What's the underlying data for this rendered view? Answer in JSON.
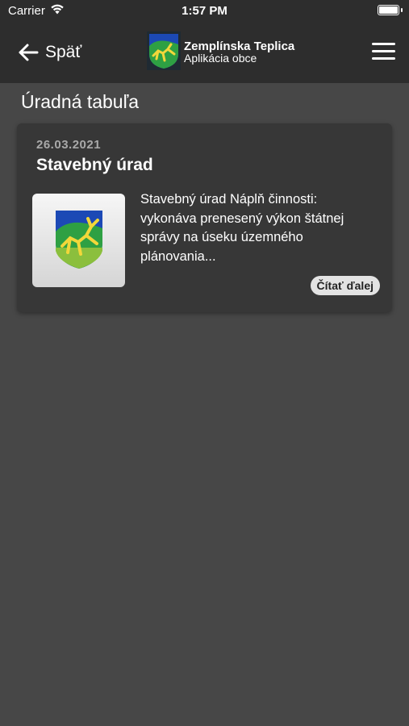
{
  "status_bar": {
    "carrier": "Carrier",
    "time": "1:57 PM",
    "icons": [
      "wifi-icon",
      "battery-icon"
    ]
  },
  "header": {
    "back_label": "Späť",
    "back_icon": "arrow-left-icon",
    "brand_title": "Zemplínska Teplica",
    "brand_subtitle": "Aplikácia obce",
    "logo_icon": "coat-of-arms-icon",
    "menu_icon": "hamburger-menu-icon",
    "background_color": "#2d2d2d"
  },
  "page": {
    "title": "Úradná tabuľa",
    "background_color": "#474747"
  },
  "items": [
    {
      "date": "26.03.2021",
      "title": "Stavebný úrad",
      "excerpt": "Stavebný úrad Náplň činnosti: vykonáva prenesený výkon štátnej správy na úseku územného plánovania...",
      "read_more_label": "Čítať ďalej",
      "thumbnail_icon": "coat-of-arms-icon"
    }
  ]
}
